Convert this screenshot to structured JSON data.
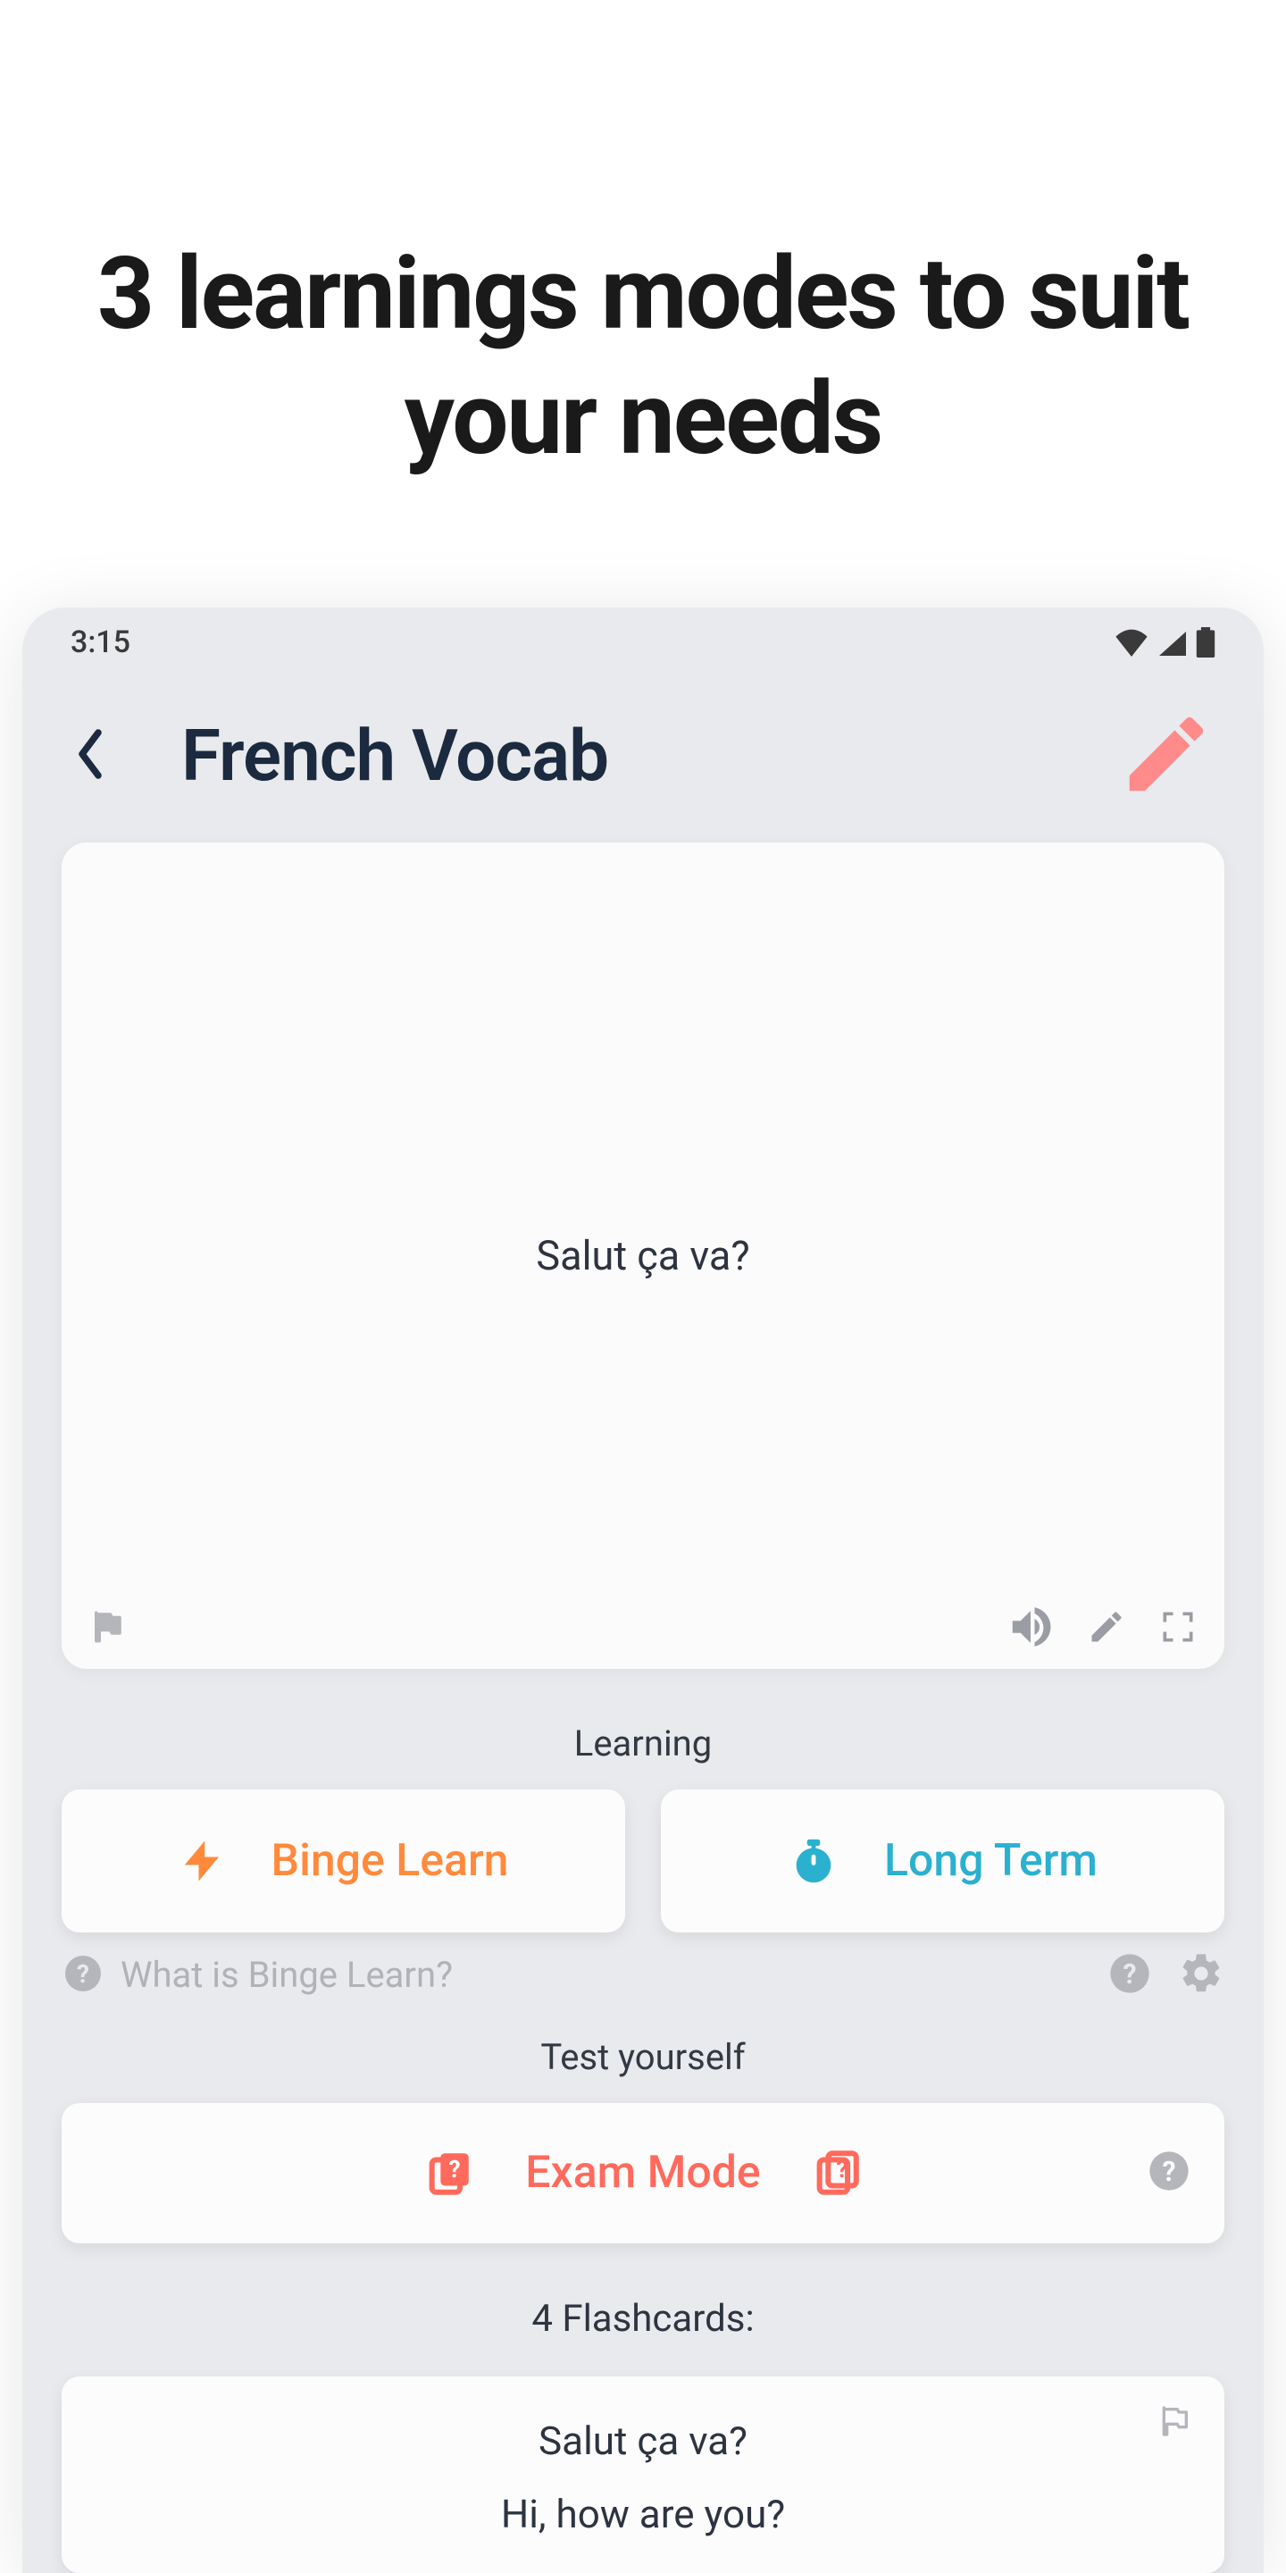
{
  "headline": "3 learnings modes to suit your needs",
  "statusbar": {
    "time": "3:15"
  },
  "titlebar": {
    "title": "French Vocab"
  },
  "card": {
    "text": "Salut ça va?"
  },
  "learning": {
    "section_label": "Learning",
    "binge_label": "Binge Learn",
    "longterm_label": "Long Term",
    "info_label": "What is Binge Learn?"
  },
  "testing": {
    "section_label": "Test yourself",
    "exam_label": "Exam Mode"
  },
  "flashcards": {
    "count_label": "4 Flashcards:",
    "item": {
      "front": "Salut ça va?",
      "back": "Hi, how are you?"
    }
  },
  "colors": {
    "accent_orange": "#ff8a3c",
    "accent_teal": "#2bb0cf",
    "accent_coral": "#ff6a5c",
    "pencil": "#ff8a8a"
  }
}
